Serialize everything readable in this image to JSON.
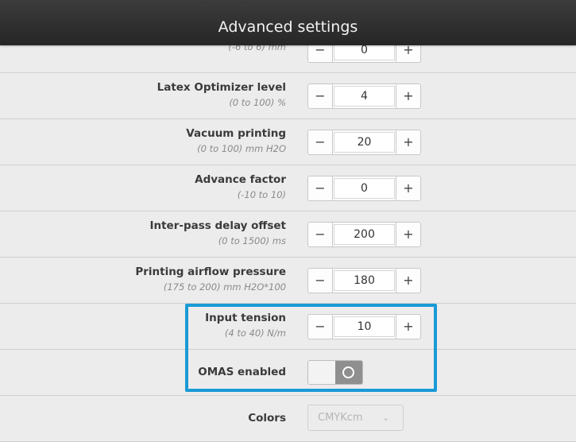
{
  "header": {
    "title": "Advanced settings"
  },
  "settings": [
    {
      "label": "",
      "range": "(-6 to 6) mm",
      "value": "0"
    },
    {
      "label": "Latex Optimizer level",
      "range": "(0 to 100) %",
      "value": "4"
    },
    {
      "label": "Vacuum printing",
      "range": "(0 to 100) mm H2O",
      "value": "20"
    },
    {
      "label": "Advance factor",
      "range": "(-10 to 10)",
      "value": "0"
    },
    {
      "label": "Inter-pass delay offset",
      "range": "(0 to 1500) ms",
      "value": "200"
    },
    {
      "label": "Printing airflow pressure",
      "range": "(175 to 200) mm H2O*100",
      "value": "180"
    },
    {
      "label": "Input tension",
      "range": "(4 to 40) N/m",
      "value": "10"
    }
  ],
  "stepper": {
    "minus": "−",
    "plus": "+"
  },
  "omas": {
    "label": "OMAS enabled",
    "state": "off"
  },
  "colors": {
    "label": "Colors",
    "value": "CMYKcm",
    "chevron": "⌄"
  },
  "highlight_color": "#1a9ad6"
}
